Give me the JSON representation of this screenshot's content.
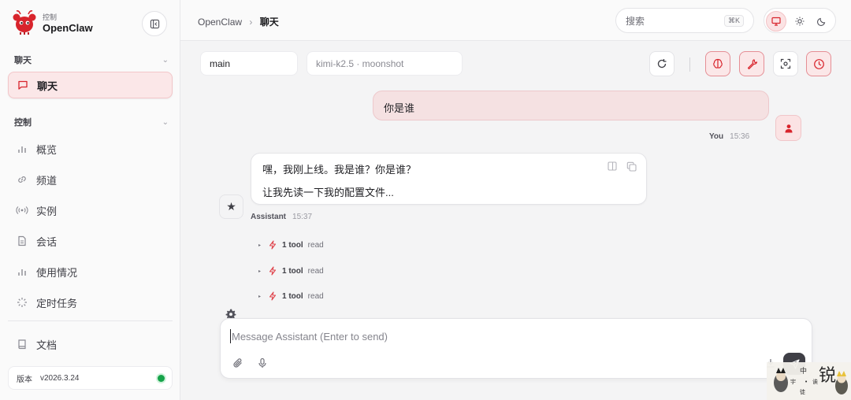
{
  "brand": {
    "subtitle": "控制",
    "name": "OpenClaw"
  },
  "sidebar": {
    "chat_section": {
      "title": "聊天"
    },
    "chat_items": [
      {
        "label": "聊天",
        "icon": "message-square-icon",
        "active": true
      }
    ],
    "control_section": {
      "title": "控制"
    },
    "control_items": [
      {
        "label": "概览",
        "icon": "bar-chart-icon"
      },
      {
        "label": "频道",
        "icon": "link-icon"
      },
      {
        "label": "实例",
        "icon": "radio-signal-icon"
      },
      {
        "label": "会话",
        "icon": "file-text-icon"
      },
      {
        "label": "使用情况",
        "icon": "bar-chart-icon"
      },
      {
        "label": "定时任务",
        "icon": "loader-icon"
      }
    ],
    "docs_item": {
      "label": "文档",
      "icon": "book-icon"
    },
    "version": {
      "label": "版本",
      "value": "v2026.3.24",
      "status_color": "#16a34a"
    }
  },
  "topbar": {
    "breadcrumb": {
      "root": "OpenClaw",
      "separator": "›",
      "current": "聊天"
    },
    "search": {
      "placeholder": "搜索",
      "shortcut": "⌘K"
    },
    "theme": {
      "active": "monitor"
    }
  },
  "controls": {
    "session": "main",
    "model": "kimi-k2.5 · moonshot"
  },
  "messages": [
    {
      "role": "user",
      "text": "你是谁",
      "author": "You",
      "time": "15:36"
    },
    {
      "role": "assistant",
      "lines": [
        "嘿，我刚上线。我是谁？你是谁？",
        "让我先读一下我的配置文件..."
      ],
      "author": "Assistant",
      "time": "15:37",
      "tools": [
        {
          "count": "1 tool",
          "name": "read"
        },
        {
          "count": "1 tool",
          "name": "read"
        },
        {
          "count": "1 tool",
          "name": "read"
        }
      ]
    }
  ],
  "composer": {
    "placeholder": "Message Assistant (Enter to send)"
  },
  "watermark": {
    "text": [
      "中",
      "宇",
      "•",
      "诶",
      "锐",
      "锐",
      "徒"
    ]
  },
  "colors": {
    "accent": "#e0474f",
    "accent_soft": "#fbe7e8",
    "online": "#16a34a"
  }
}
